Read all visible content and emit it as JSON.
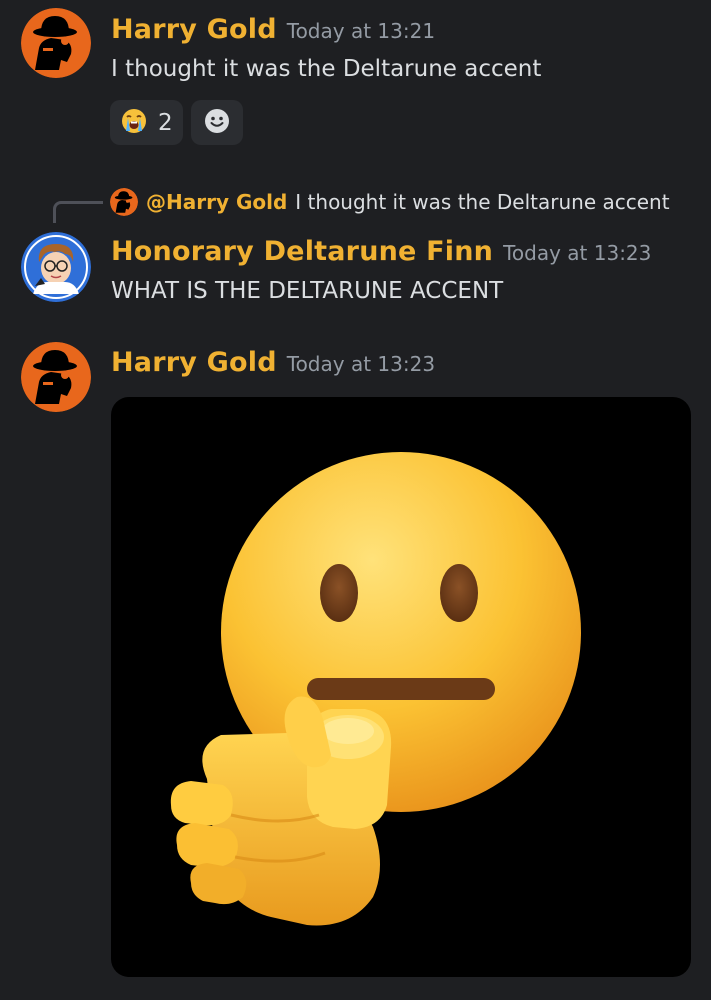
{
  "messages": [
    {
      "author": "Harry Gold",
      "timestamp": "Today at 13:21",
      "text": "I thought it was the Deltarune accent",
      "avatar_icon": "bowler-hat-silhouette-avatar",
      "reactions": [
        {
          "emoji": "loudly-crying-face-icon",
          "count": "2"
        },
        {
          "emoji": "add-reaction-smiley-icon",
          "count": ""
        }
      ]
    },
    {
      "reply": {
        "mention": "@Harry Gold",
        "text": "I thought it was the Deltarune accent"
      },
      "author": "Honorary Deltarune Finn",
      "timestamp": "Today at 13:23",
      "text": "WHAT IS THE DELTARUNE ACCENT",
      "avatar_icon": "cartoon-character-avatar"
    },
    {
      "author": "Harry Gold",
      "timestamp": "Today at 13:23",
      "attachment": "neutral-face-pointing-emoji-image",
      "avatar_icon": "bowler-hat-silhouette-avatar"
    }
  ],
  "colors": {
    "background": "#1e1f22",
    "username": "#f0b132",
    "timestamp": "#949ba4",
    "text": "#dbdee1",
    "reaction_bg": "#2b2d31",
    "avatar_orange": "#e8671c",
    "avatar_blue": "#2f6fd8"
  }
}
